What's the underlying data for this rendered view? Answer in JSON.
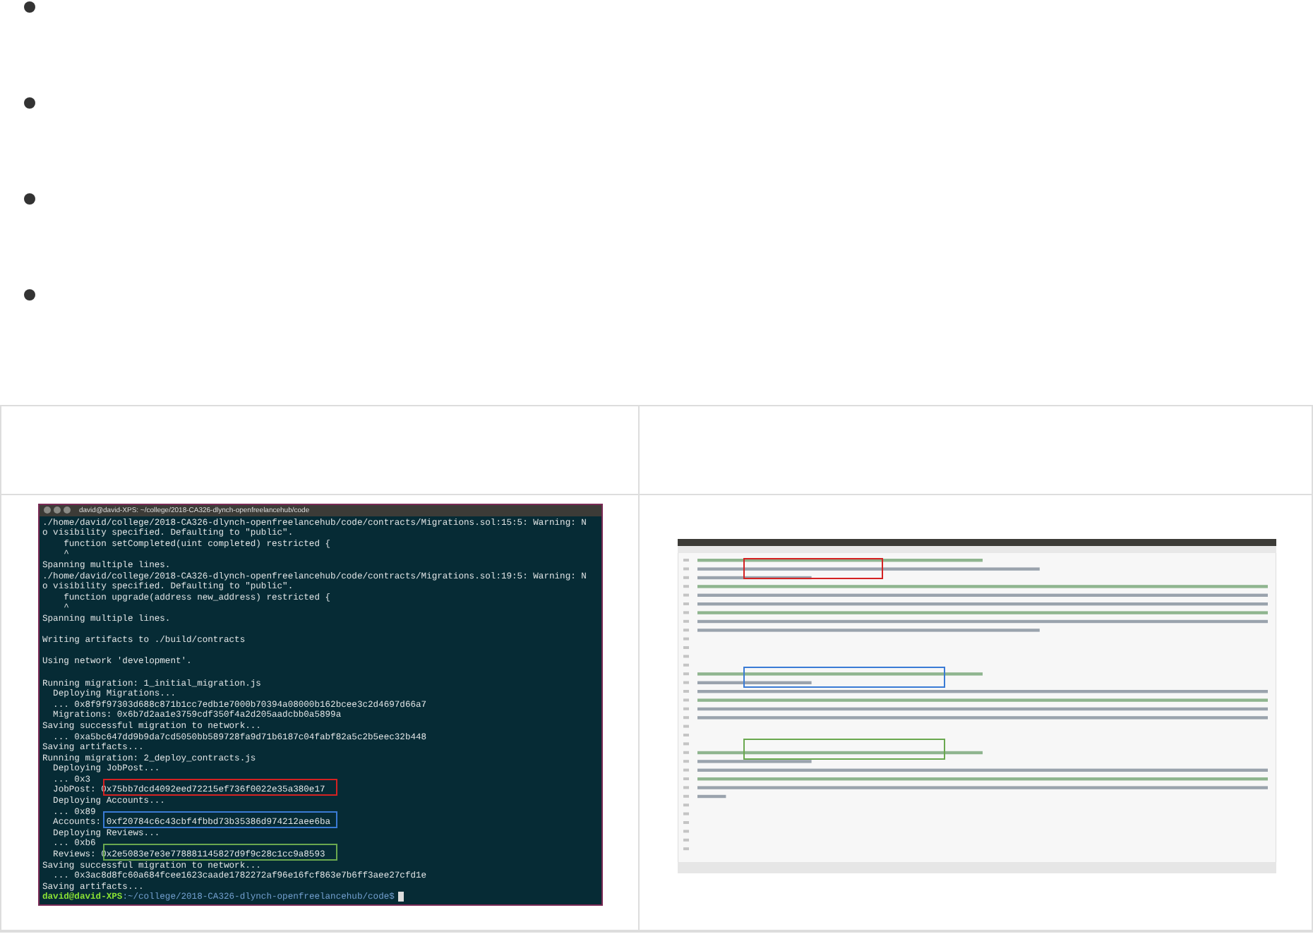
{
  "bullet_list": [
    {
      "kind": "bullet"
    },
    {
      "kind": "bullet"
    },
    {
      "kind": "bullet"
    },
    {
      "kind": "bullet"
    }
  ],
  "table": {
    "rows": [
      {
        "cells": [
          {
            "kind": "terminal",
            "title": "david@david-XPS: ~/college/2018-CA326-dlynch-openfreelancehub/code",
            "blocks": [
              {
                "lines": [
                  {
                    "text": "./home/david/college/2018-CA326-dlynch-openfreelancehub/code/contracts/Migrations.sol:15:5: Warning: N"
                  },
                  {
                    "text": "o visibility specified. Defaulting to \"public\"."
                  },
                  {
                    "text": "    function setCompleted(uint completed) restricted {"
                  },
                  {
                    "text": "    ^"
                  },
                  {
                    "text": "Spanning multiple lines."
                  },
                  {
                    "text": "./home/david/college/2018-CA326-dlynch-openfreelancehub/code/contracts/Migrations.sol:19:5: Warning: N"
                  },
                  {
                    "text": "o visibility specified. Defaulting to \"public\"."
                  },
                  {
                    "text": "    function upgrade(address new_address) restricted {"
                  },
                  {
                    "text": "    ^"
                  },
                  {
                    "text": "Spanning multiple lines."
                  }
                ]
              },
              {
                "lines": [
                  {
                    "text": "Writing artifacts to ./build/contracts"
                  }
                ]
              },
              {
                "lines": [
                  {
                    "text": "Using network 'development'."
                  }
                ]
              },
              {
                "lines": [
                  {
                    "text": "Running migration: 1_initial_migration.js"
                  },
                  {
                    "text": "  Deploying Migrations..."
                  },
                  {
                    "text": "  ... 0x8f9f97303d688c871b1cc7edb1e7000b70394a08000b162bcee3c2d4697d66a7"
                  },
                  {
                    "text": "  Migrations: 0x6b7d2aa1e3759cdf350f4a2d205aadcbb0a5899a"
                  },
                  {
                    "text": "Saving successful migration to network..."
                  },
                  {
                    "text": "  ... 0xa5bc647dd9b9da7cd5050bb589728fa9d71b6187c04fabf82a5c2b5eec32b448"
                  },
                  {
                    "text": "Saving artifacts..."
                  },
                  {
                    "text": "Running migration: 2_deploy_contracts.js"
                  },
                  {
                    "text": "  Deploying JobPost..."
                  },
                  {
                    "text": "  ... 0x3"
                  },
                  {
                    "text": "  JobPost: 0x75bb7dcd4092eed72215ef736f0022e35a380e17",
                    "color": "#d42222"
                  },
                  {
                    "text": "  Deploying Accounts..."
                  },
                  {
                    "text": "  ... 0x89"
                  },
                  {
                    "text": "  Accounts: 0xf20784c6c43cbf4fbbd73b35386d974212aee6ba",
                    "color": "#3a7bd5"
                  },
                  {
                    "text": "  Deploying Reviews..."
                  },
                  {
                    "text": "  ... 0xb6"
                  },
                  {
                    "text": "  Reviews: 0x2e5083e7e3e778881145827d9f9c28c1cc9a8593",
                    "color": "#6aa84f"
                  },
                  {
                    "text": "Saving successful migration to network..."
                  },
                  {
                    "text": "  ... 0x3ac8d8fc60a684fcee1623caade1782272af96e16fcf863e7b6ff3aee27cfd1e"
                  },
                  {
                    "text": "Saving artifacts..."
                  }
                ]
              }
            ],
            "prompt_user": "david@david-XPS",
            "prompt_path": ":~/college/2018-CA326-dlynch-openfreelancehub/code$"
          },
          {
            "kind": "editor"
          }
        ]
      }
    ]
  }
}
